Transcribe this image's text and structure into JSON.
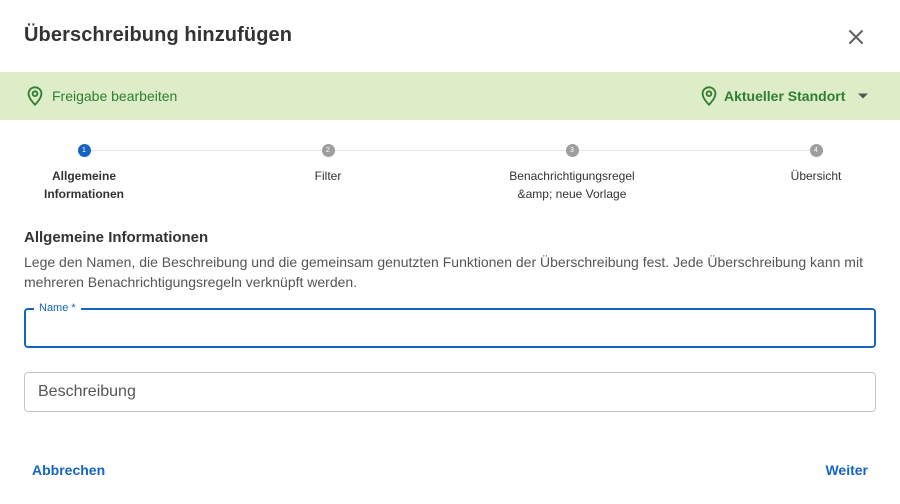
{
  "dialog": {
    "title": "Überschreibung hinzufügen"
  },
  "banner": {
    "left_label": "Freigabe bearbeiten",
    "right_label": "Aktueller Standort",
    "color": "#2e7d32",
    "background": "#dcedc8"
  },
  "stepper": {
    "steps": [
      {
        "number": "1",
        "label": "Allgemeine Informationen",
        "state": "active"
      },
      {
        "number": "2",
        "label": "Filter",
        "state": "inactive"
      },
      {
        "number": "3",
        "label": "Benachrichtigungsregel &amp; neue Vorlage",
        "state": "inactive"
      },
      {
        "number": "4",
        "label": "Übersicht",
        "state": "inactive"
      }
    ],
    "active_color": "#1565c0",
    "inactive_color": "#9e9e9e"
  },
  "section": {
    "title": "Allgemeine Informationen",
    "description": "Lege den Namen, die Beschreibung und die gemeinsam genutzten Funktionen der Überschreibung fest. Jede Überschreibung kann mit mehreren Benachrichtigungsregeln verknüpft werden."
  },
  "form": {
    "name_label": "Name *",
    "name_value": "",
    "description_placeholder": "Beschreibung",
    "description_value": ""
  },
  "footer": {
    "cancel_label": "Abbrechen",
    "next_label": "Weiter"
  },
  "icons": {
    "close": "close-icon",
    "location": "map-pin-icon",
    "dropdown": "caret-down-icon"
  }
}
